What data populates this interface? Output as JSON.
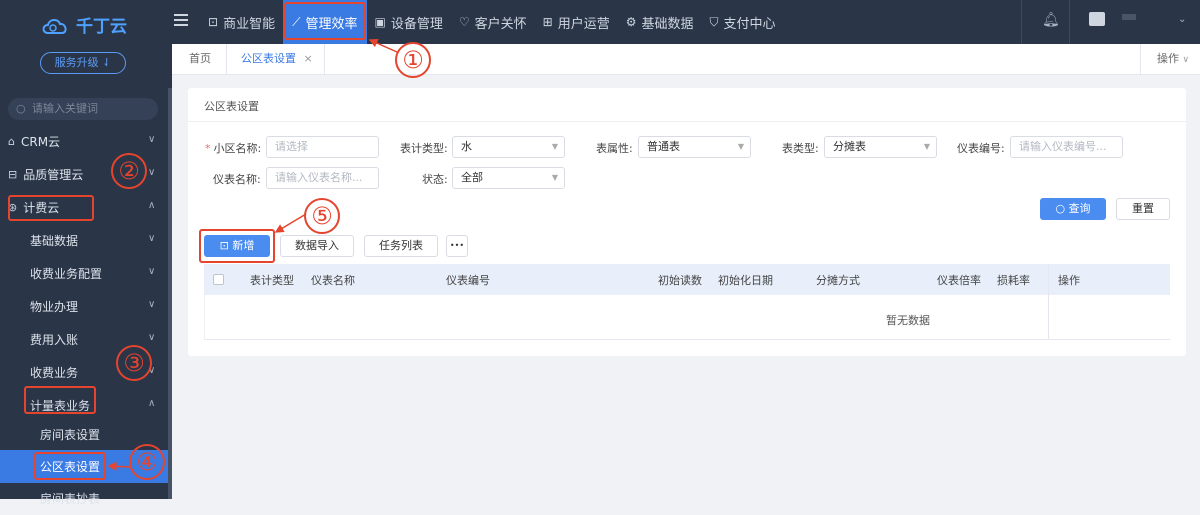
{
  "app": {
    "logo_text": "千丁云",
    "upgrade_label": "服务升级 ⇃"
  },
  "topnav": [
    {
      "icon": "chart-icon",
      "label": "商业智能"
    },
    {
      "icon": "trend-icon",
      "label": "管理效率"
    },
    {
      "icon": "device-icon",
      "label": "设备管理"
    },
    {
      "icon": "heart-icon",
      "label": "客户关怀"
    },
    {
      "icon": "user-ops-icon",
      "label": "用户运营"
    },
    {
      "icon": "wrench-icon",
      "label": "基础数据"
    },
    {
      "icon": "shield-icon",
      "label": "支付中心"
    }
  ],
  "sidebar": {
    "search_placeholder": "请输入关键词",
    "items": [
      {
        "label": "CRM云"
      },
      {
        "label": "品质管理云"
      },
      {
        "label": "计费云"
      },
      {
        "label": "基础数据"
      },
      {
        "label": "收费业务配置"
      },
      {
        "label": "物业办理"
      },
      {
        "label": "费用入账"
      },
      {
        "label": "收费业务"
      },
      {
        "label": "计量表业务"
      },
      {
        "label": "房间表设置"
      },
      {
        "label": "公区表设置"
      },
      {
        "label": "房间表抄表"
      }
    ]
  },
  "tabs": {
    "home": "首页",
    "current": "公区表设置",
    "close": "×",
    "ops": "操作"
  },
  "card": {
    "title": "公区表设置"
  },
  "form": {
    "community_label": "小区名称:",
    "community_placeholder": "请选择",
    "meter_type_label": "表计类型:",
    "meter_type_value": "水",
    "attr_label": "表属性:",
    "attr_value": "普通表",
    "kind_label": "表类型:",
    "kind_value": "分摊表",
    "code_label": "仪表编号:",
    "code_placeholder": "请输入仪表编号...",
    "name_label": "仪表名称:",
    "name_placeholder": "请输入仪表名称...",
    "status_label": "状态:",
    "status_value": "全部"
  },
  "buttons": {
    "query": "查询",
    "reset": "重置",
    "add": "新增",
    "import": "数据导入",
    "tasks": "任务列表",
    "more": "•••"
  },
  "table": {
    "columns": [
      "表计类型",
      "仪表名称",
      "仪表编号",
      "初始读数",
      "初始化日期",
      "分摊方式",
      "仪表倍率",
      "损耗率",
      "操作"
    ],
    "empty_text": "暂无数据"
  },
  "annotations": [
    "①",
    "②",
    "③",
    "④",
    "⑤"
  ]
}
